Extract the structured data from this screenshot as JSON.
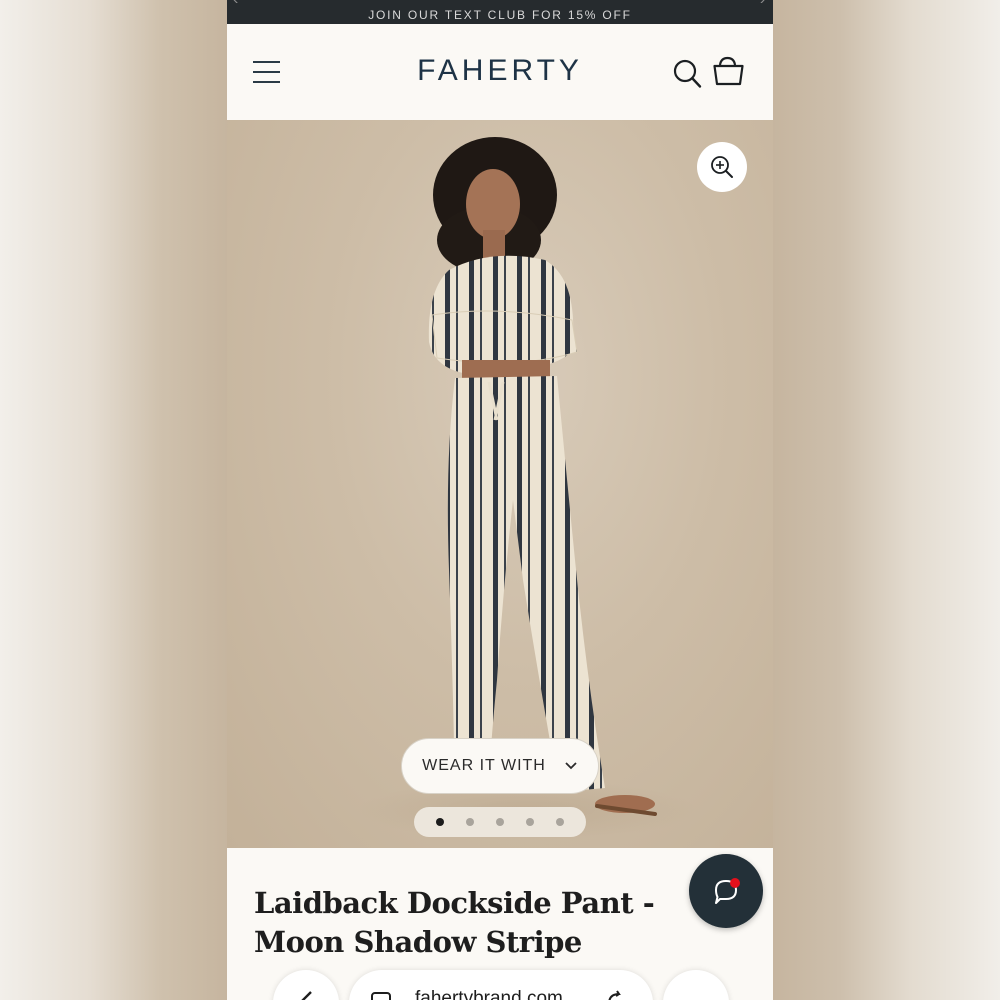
{
  "promo_bar": {
    "text": "JOIN OUR TEXT CLUB FOR 15% OFF",
    "prev_arrow": "‹",
    "next_arrow": "›"
  },
  "header": {
    "logo": "FAHERTY",
    "icons": [
      "menu-icon",
      "search-icon",
      "shopping-bag-icon"
    ]
  },
  "gallery": {
    "wear_it_with_label": "WEAR IT WITH",
    "slide_count": 5,
    "active_slide": 1,
    "icons": [
      "zoom-in-icon",
      "chevron-down-icon"
    ]
  },
  "product": {
    "title": "Laidback Dockside Pant - Moon Shadow Stripe"
  },
  "chat": {
    "icon": "chat-bubble-icon",
    "notification_color": "#e4101c"
  },
  "browser_bar": {
    "url": "fahertybrand.com",
    "icons": [
      "back-arrow-icon",
      "tabs-icon",
      "reload-icon",
      "more-icon"
    ]
  },
  "colors": {
    "brand_navy": "#1e3346",
    "promo_bar_bg": "#262b2e",
    "chat_button_bg": "#233038",
    "page_bg": "#fbf9f5"
  }
}
